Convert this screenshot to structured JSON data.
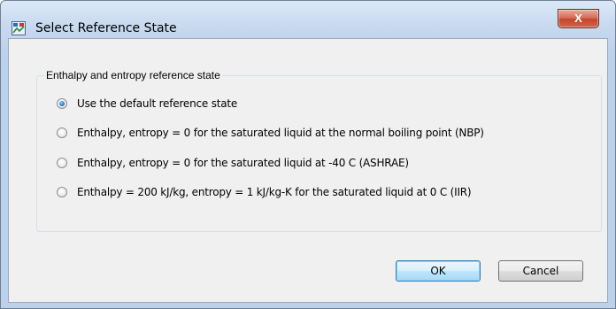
{
  "window": {
    "title": "Select Reference State",
    "close_glyph": "X",
    "icon": "app-icon"
  },
  "groupbox": {
    "legend": "Enthalpy and entropy reference state"
  },
  "options": [
    {
      "label": "Use the default reference state",
      "checked": true
    },
    {
      "label": "Enthalpy, entropy = 0 for the saturated liquid at the normal boiling point (NBP)",
      "checked": false
    },
    {
      "label": "Enthalpy, entropy = 0 for the saturated liquid at -40 C (ASHRAE)",
      "checked": false
    },
    {
      "label": "Enthalpy = 200 kJ/kg, entropy = 1 kJ/kg-K for the saturated liquid at 0 C (IIR)",
      "checked": false
    }
  ],
  "buttons": {
    "ok": "OK",
    "cancel": "Cancel"
  },
  "colors": {
    "title_bar": "#c7d9ef",
    "close_button": "#c4452c",
    "default_button_border": "#3c7fb1",
    "dialog_background": "#f0f0f0"
  }
}
